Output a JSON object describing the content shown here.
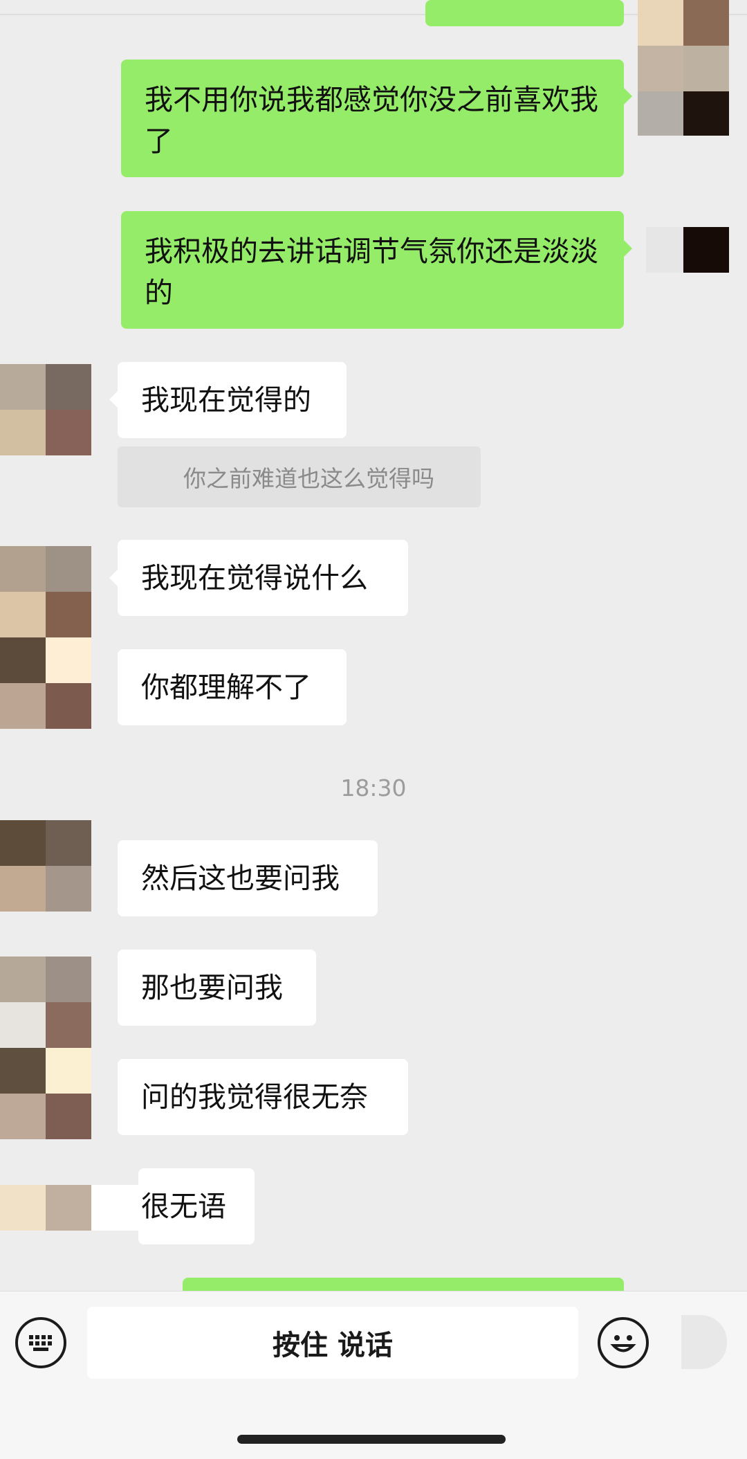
{
  "messages": {
    "out1_partial": "",
    "out2": "我不用你说我都感觉你没之前喜欢我了",
    "out3": "我积极的去讲话调节气氛你还是淡淡的",
    "in1": "我现在觉得的",
    "quote1": "你之前难道也这么觉得吗",
    "in2": "我现在觉得说什么",
    "in3": "你都理解不了",
    "time1": "18:30",
    "in4": "然后这也要问我",
    "in5": "那也要问我",
    "in6": "问的我觉得很无奈",
    "in7": "很无语"
  },
  "input_bar": {
    "hold_to_talk": "按住 说话",
    "keyboard_icon": "keyboard-icon",
    "emoji_icon": "emoji-icon"
  },
  "colors": {
    "background": "#ededed",
    "outgoing_bubble": "#95ec69",
    "incoming_bubble": "#ffffff"
  }
}
